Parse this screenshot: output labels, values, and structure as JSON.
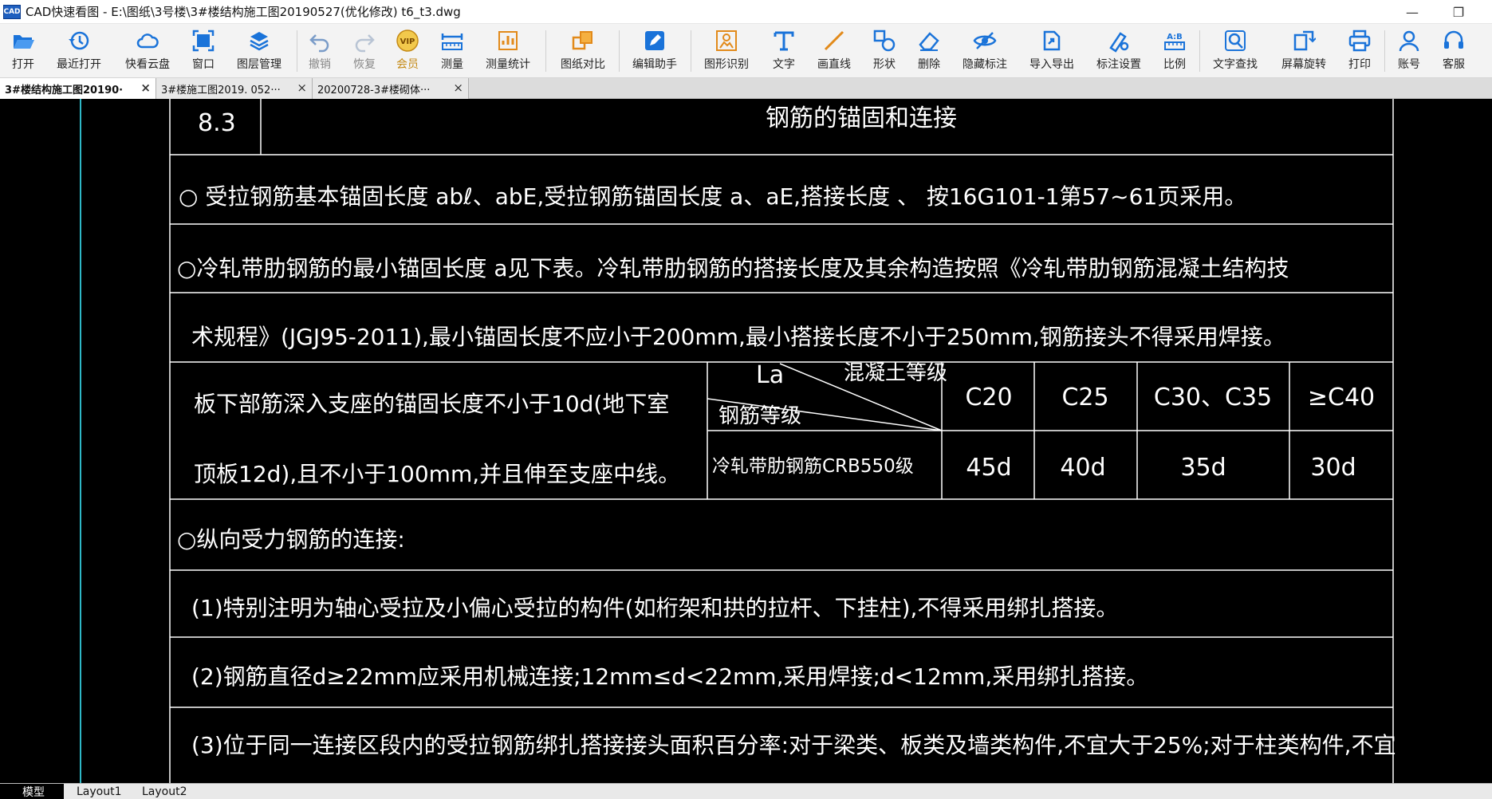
{
  "window": {
    "logo_text": "CAD",
    "title": "CAD快速看图 - E:\\图纸\\3号楼\\3#楼结构施工图20190527(优化修改)  t6_t3.dwg",
    "minimize": "—",
    "restore": "❐"
  },
  "toolbar": {
    "open": "打开",
    "recent": "最近打开",
    "cloud": "快看云盘",
    "viewport": "窗口",
    "layers": "图层管理",
    "undo": "撤销",
    "redo": "恢复",
    "vip": "会员",
    "vip_badge": "VIP",
    "measure": "测量",
    "measure_stats": "测量统计",
    "compare": "图纸对比",
    "edit_helper": "编辑助手",
    "recognize": "图形识别",
    "text": "文字",
    "line": "画直线",
    "shape": "形状",
    "delete": "删除",
    "hide_marks": "隐藏标注",
    "import_export": "导入导出",
    "mark_settings": "标注设置",
    "scale": "比例",
    "scale_icon_text": "A:B",
    "text_search": "文字查找",
    "rotate": "屏幕旋转",
    "print": "打印",
    "account": "账号",
    "service": "客服"
  },
  "file_tabs": [
    {
      "name": "3#楼结构施工图20190·",
      "close": "×"
    },
    {
      "name": "3#楼施工图2019. 052···",
      "close": "×"
    },
    {
      "name": "20200728-3#楼砌体···",
      "close": "×"
    }
  ],
  "drawing": {
    "section_no": "8.3",
    "section_title": "钢筋的锚固和连接",
    "row1": "○  受拉钢筋基本锚固长度  abℓ、abE,受拉钢筋锚固长度 a、aE,搭接长度   、   按16G101-1第57~61页采用。",
    "row2": "○冷轧带肋钢筋的最小锚固长度 a见下表。冷轧带肋钢筋的搭接长度及其余构造按照《冷轧带肋钢筋混凝土结构技",
    "row3": "术规程》(JGJ95-2011),最小锚固长度不应小于200mm,最小搭接长度不小于250mm,钢筋接头不得采用焊接。",
    "row4_left": "板下部筋深入支座的锚固长度不小于10d(地下室",
    "row5_left": "顶板12d),且不小于100mm,并且伸至支座中线。",
    "diag_la": "La",
    "diag_concrete": "混凝土等级",
    "diag_steel": "钢筋等级",
    "grades": [
      "C20",
      "C25",
      "C30、C35",
      "≥C40"
    ],
    "steel_type": "冷轧带肋钢筋CRB550级",
    "values": [
      "45d",
      "40d",
      "35d",
      "30d"
    ],
    "row6": "○纵向受力钢筋的连接:",
    "row7": "(1)特别注明为轴心受拉及小偏心受拉的构件(如桁架和拱的拉杆、下挂柱),不得采用绑扎搭接。",
    "row8": "(2)钢筋直径d≥22mm应采用机械连接;12mm≤d<22mm,采用焊接;d<12mm,采用绑扎搭接。",
    "row9": "(3)位于同一连接区段内的受拉钢筋绑扎搭接接头面积百分率:对于梁类、板类及墙类构件,不宜大于25%;对于柱类构件,不宜"
  },
  "layout_tabs": {
    "model": "模型",
    "layout1": "Layout1",
    "layout2": "Layout2"
  },
  "colors": {
    "accent": "#1a73d9",
    "vip": "#d4a017",
    "drawing_line": "#ffffff",
    "cyan_line": "#2fb8c7"
  }
}
